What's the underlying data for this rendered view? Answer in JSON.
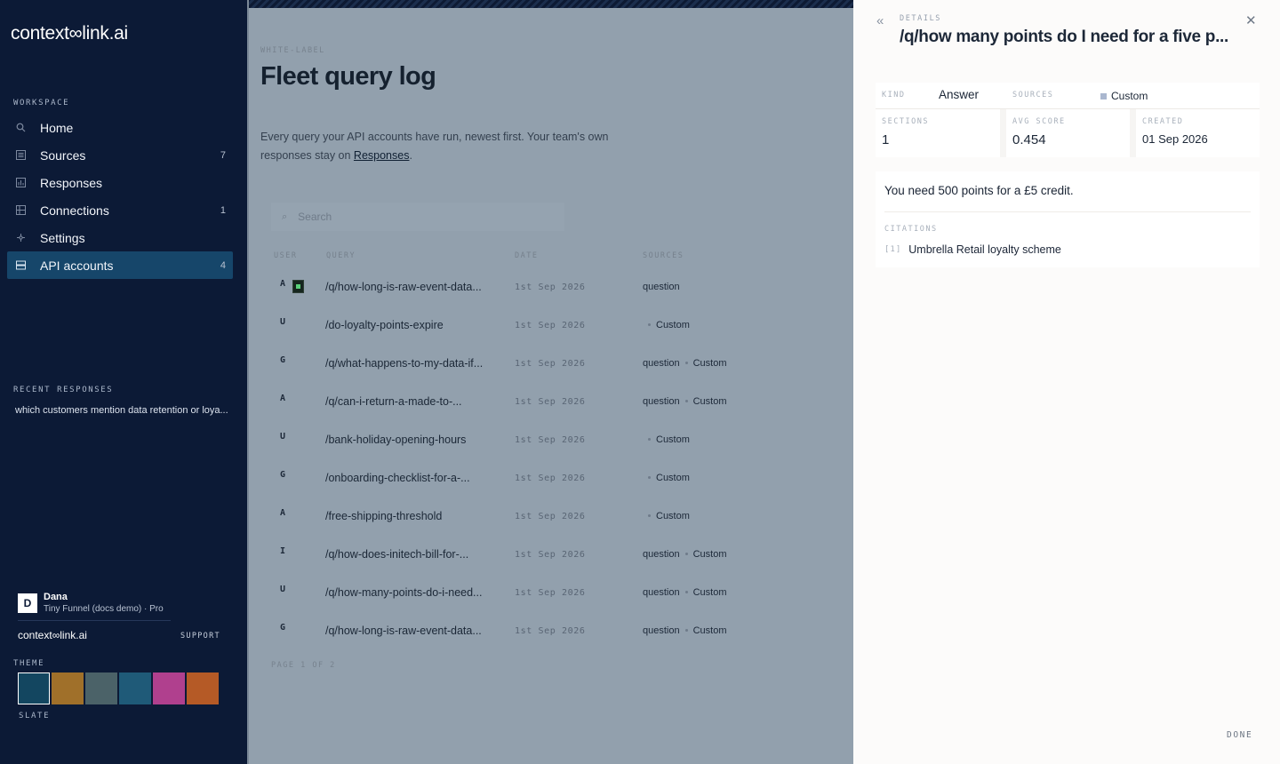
{
  "brand": {
    "logo_text": "context∞link.ai",
    "footer_logo_text": "context∞link.ai"
  },
  "sidebar": {
    "workspace_label": "WORKSPACE",
    "items": [
      {
        "label": "Home",
        "icon": "search-icon",
        "count": ""
      },
      {
        "label": "Sources",
        "icon": "list-icon",
        "count": "7"
      },
      {
        "label": "Responses",
        "icon": "chart-icon",
        "count": ""
      },
      {
        "label": "Connections",
        "icon": "grid-icon",
        "count": "1"
      },
      {
        "label": "Settings",
        "icon": "gear-icon",
        "count": ""
      },
      {
        "label": "API accounts",
        "icon": "server-icon",
        "count": "4",
        "active": true
      }
    ],
    "recent_label": "RECENT RESPONSES",
    "recent_items": [
      "which customers mention data retention or loya..."
    ],
    "user": {
      "initial": "D",
      "name": "Dana",
      "org": "Tiny Funnel (docs demo) · Pro"
    },
    "support_label": "SUPPORT",
    "theme_label": "THEME",
    "theme_name": "SLATE",
    "theme_swatches": [
      "#134660",
      "#a0702a",
      "#4b6268",
      "#1f5a78",
      "#b0408e",
      "#b55a26"
    ],
    "selected_swatch": 0
  },
  "main": {
    "eyebrow": "WHITE-LABEL",
    "title": "Fleet query log",
    "description_prefix": "Every query your API accounts have run, newest first. Your team's own responses stay on ",
    "description_link": "Responses",
    "description_suffix": ".",
    "search_placeholder": "Search",
    "columns": [
      "USER",
      "QUERY",
      "DATE",
      "SOURCES"
    ],
    "rows": [
      {
        "user": "A",
        "query": "/q/how-long-is-raw-event-data...",
        "date": "1st Sep 2026",
        "tags": [
          "question"
        ]
      },
      {
        "user": "U",
        "query": "/do-loyalty-points-expire",
        "date": "1st Sep 2026",
        "tags": [
          "Custom"
        ]
      },
      {
        "user": "G",
        "query": "/q/what-happens-to-my-data-if...",
        "date": "1st Sep 2026",
        "tags": [
          "question",
          "Custom"
        ]
      },
      {
        "user": "A",
        "query": "/q/can-i-return-a-made-to-...",
        "date": "1st Sep 2026",
        "tags": [
          "question",
          "Custom"
        ]
      },
      {
        "user": "U",
        "query": "/bank-holiday-opening-hours",
        "date": "1st Sep 2026",
        "tags": [
          "Custom"
        ]
      },
      {
        "user": "G",
        "query": "/onboarding-checklist-for-a-...",
        "date": "1st Sep 2026",
        "tags": [
          "Custom"
        ]
      },
      {
        "user": "A",
        "query": "/free-shipping-threshold",
        "date": "1st Sep 2026",
        "tags": [
          "Custom"
        ]
      },
      {
        "user": "I",
        "query": "/q/how-does-initech-bill-for-...",
        "date": "1st Sep 2026",
        "tags": [
          "question",
          "Custom"
        ]
      },
      {
        "user": "U",
        "query": "/q/how-many-points-do-i-need...",
        "date": "1st Sep 2026",
        "tags": [
          "question",
          "Custom"
        ]
      },
      {
        "user": "G",
        "query": "/q/how-long-is-raw-event-data...",
        "date": "1st Sep 2026",
        "tags": [
          "question",
          "Custom"
        ]
      }
    ],
    "pagination": "PAGE 1 OF 2"
  },
  "details": {
    "eyebrow": "DETAILS",
    "title": "/q/how many points do I need for a five p...",
    "kind_label": "KIND",
    "kind_value": "Answer",
    "sources_label": "SOURCES",
    "sources_value": "Custom",
    "sections_label": "SECTIONS",
    "sections_value": "1",
    "avg_score_label": "AVG SCORE",
    "avg_score_value": "0.454",
    "created_label": "CREATED",
    "created_value": "01 Sep 2026",
    "answer": "You need 500 points for a £5 credit.",
    "citations_label": "CITATIONS",
    "citations": [
      {
        "num": "[1]",
        "text": "Umbrella Retail loyalty scheme"
      }
    ],
    "done_label": "DONE"
  }
}
